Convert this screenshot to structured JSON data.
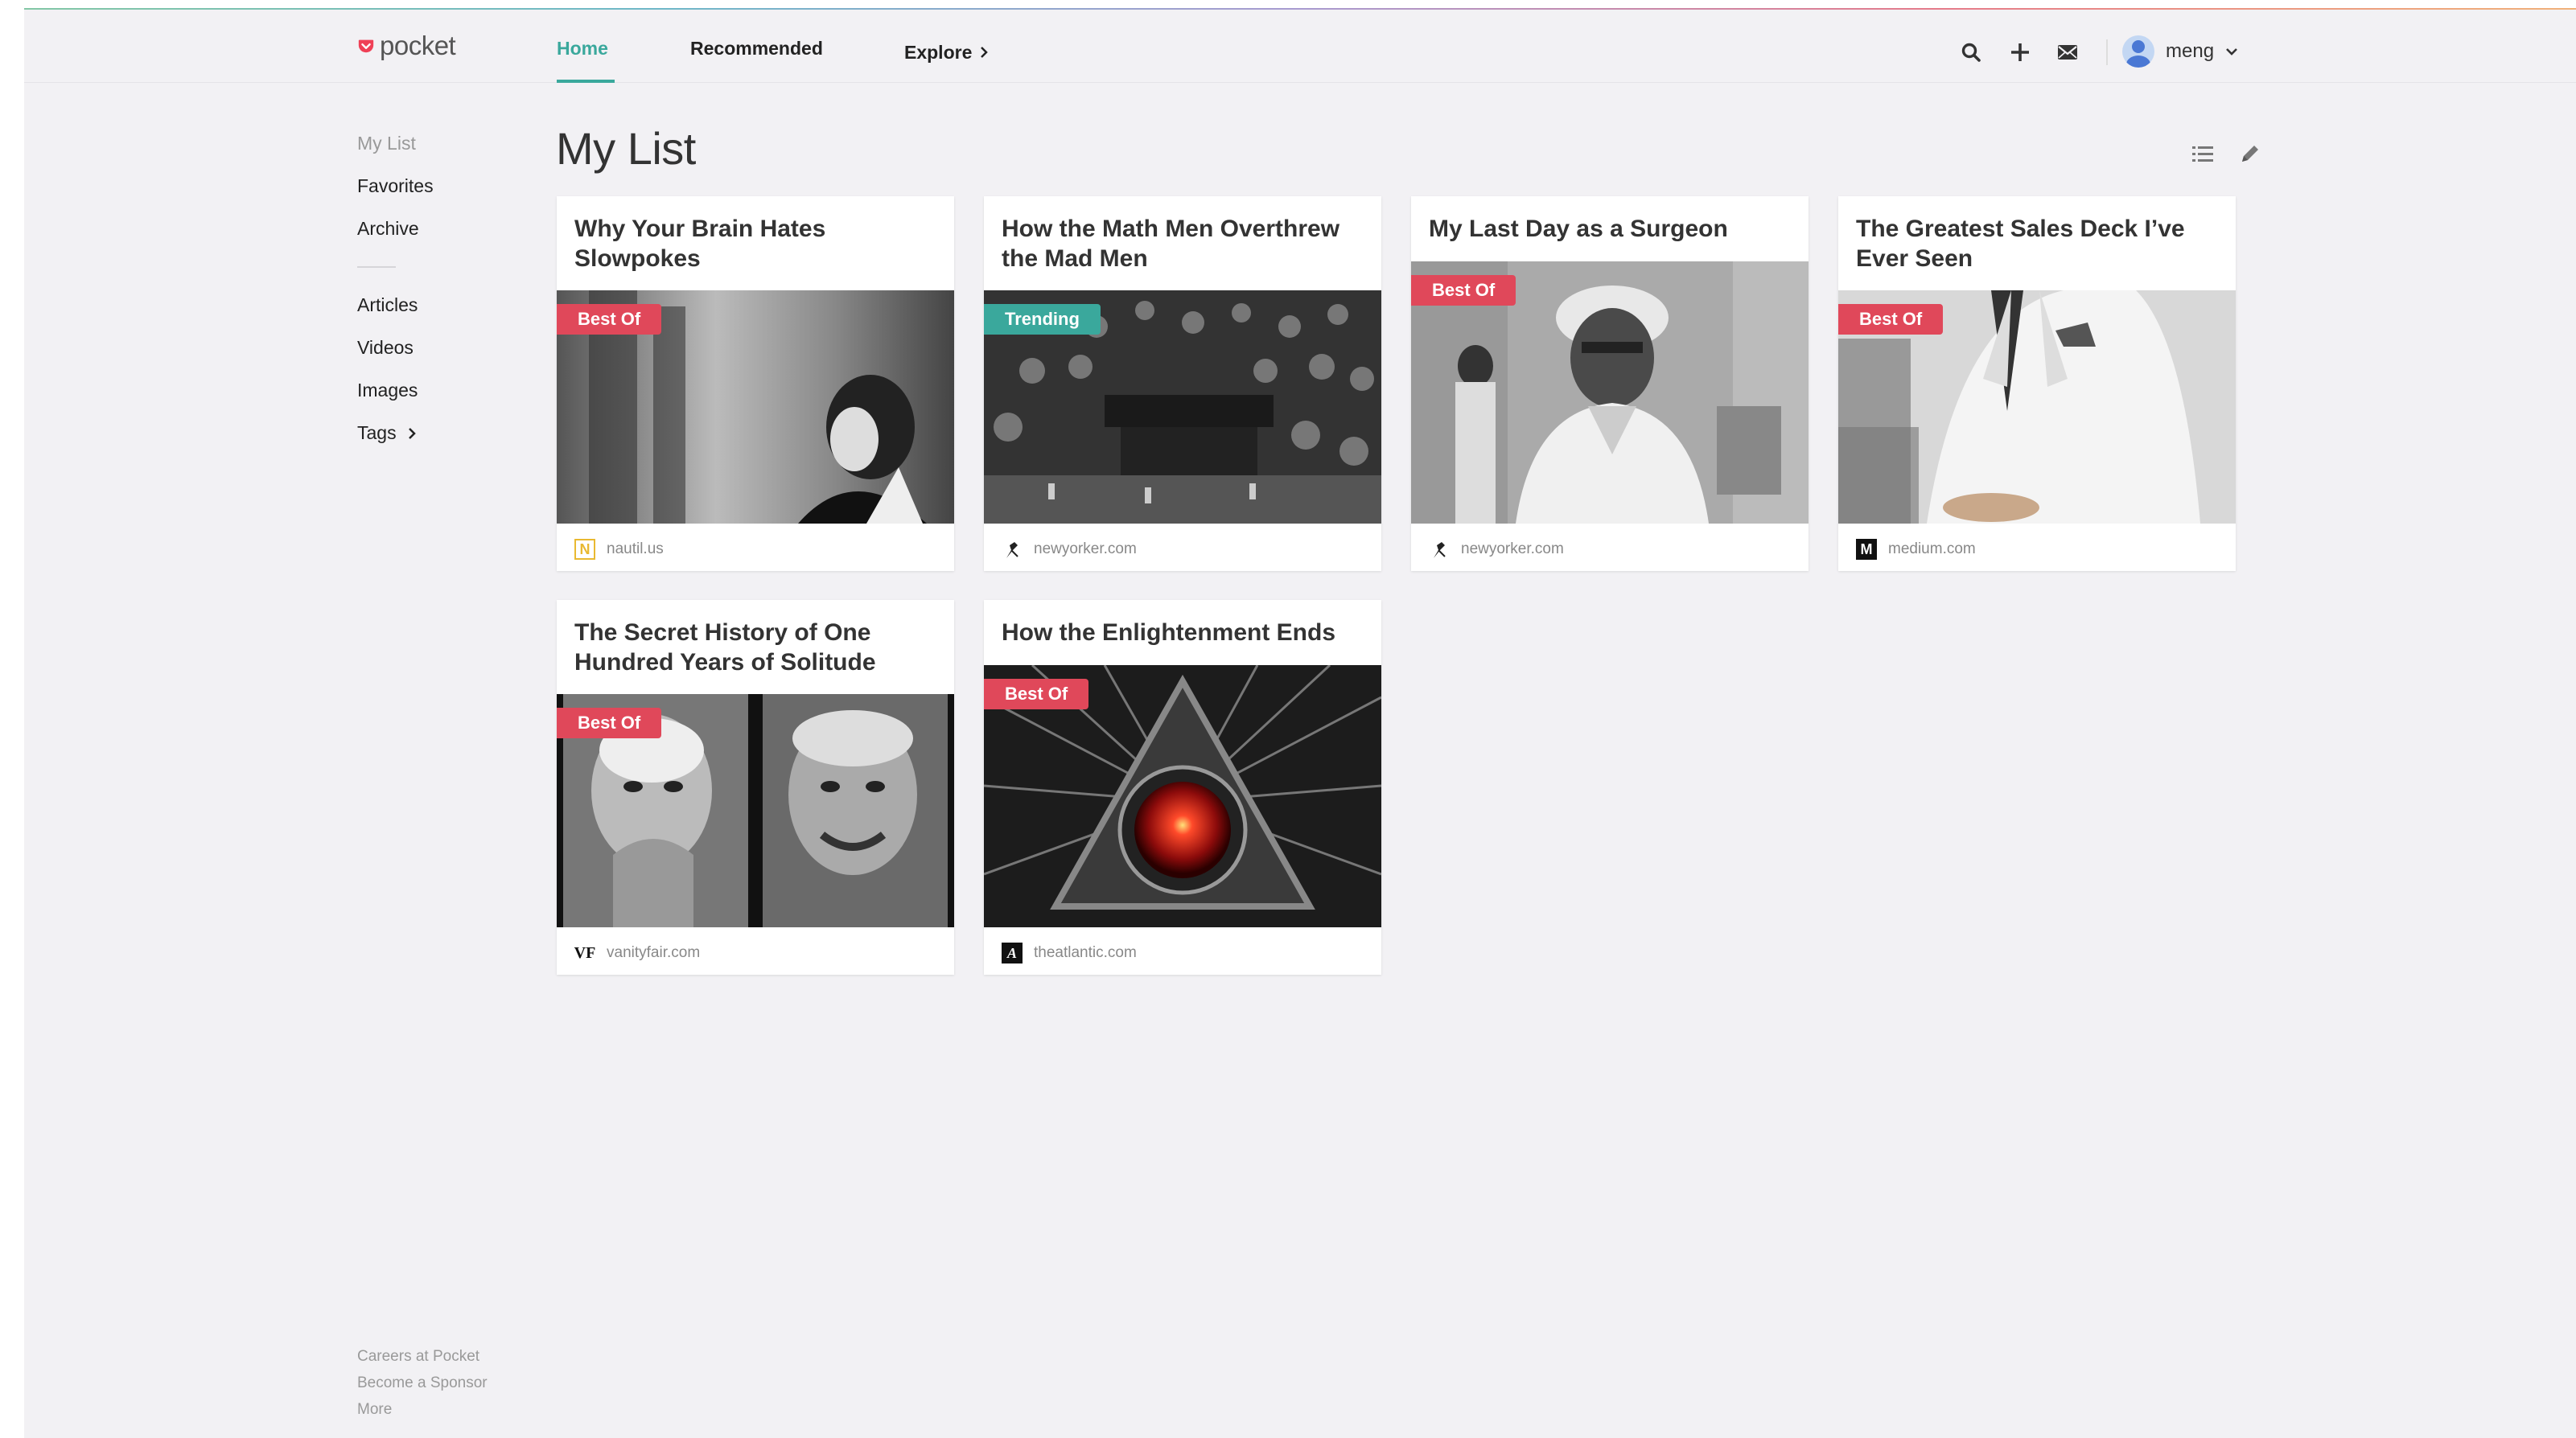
{
  "app": {
    "logo_text": "pocket",
    "brand_color": "#ef4056",
    "accent_color": "#3aa89c"
  },
  "nav": {
    "home": "Home",
    "recommended": "Recommended",
    "explore": "Explore",
    "active": "Home"
  },
  "header_icons": [
    "search-icon",
    "add-icon",
    "mail-icon",
    "chevron-down-icon"
  ],
  "user": {
    "name": "meng"
  },
  "sidebar": {
    "items": [
      {
        "label": "My List",
        "active": true
      },
      {
        "label": "Favorites"
      },
      {
        "label": "Archive"
      }
    ],
    "filters": [
      {
        "label": "Articles"
      },
      {
        "label": "Videos"
      },
      {
        "label": "Images"
      },
      {
        "label": "Tags"
      }
    ]
  },
  "footer": {
    "links": [
      "Careers at Pocket",
      "Become a Sponsor",
      "More"
    ]
  },
  "main": {
    "title": "My List",
    "cards": [
      {
        "title": "Why Your Brain Hates Slowpokes",
        "badge": "Best Of",
        "source": "nautil.us",
        "source_icon": "N"
      },
      {
        "title": "How the Math Men Overthrew the Mad Men",
        "badge": "Trending",
        "source": "newyorker.com",
        "source_icon": "newyorker-icon"
      },
      {
        "title": "My Last Day as a Surgeon",
        "badge": "Best Of",
        "source": "newyorker.com",
        "source_icon": "newyorker-icon"
      },
      {
        "title": "The Greatest Sales Deck I’ve Ever Seen",
        "badge": "Best Of",
        "source": "medium.com",
        "source_icon": "M"
      },
      {
        "title": "The Secret History of One Hundred Years of Solitude",
        "badge": "Best Of",
        "source": "vanityfair.com",
        "source_icon": "VF"
      },
      {
        "title": "How the Enlightenment Ends",
        "badge": "Best Of",
        "source": "theatlantic.com",
        "source_icon": "A"
      }
    ]
  }
}
